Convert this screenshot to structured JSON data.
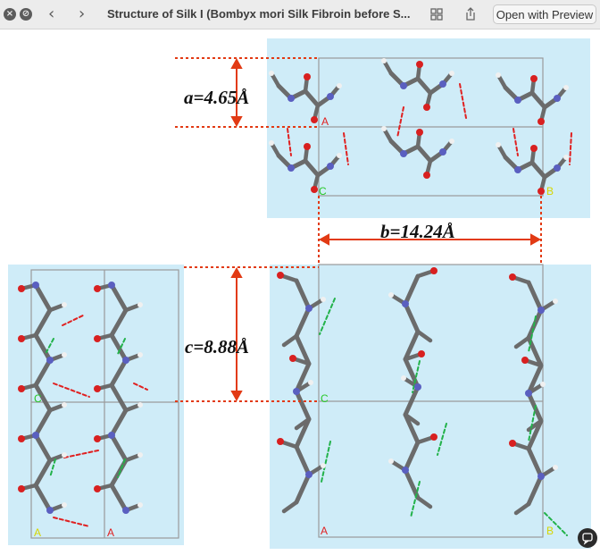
{
  "window": {
    "title": "Structure of Silk I (Bombyx mori Silk Fibroin before S...",
    "open_with_label": "Open with Preview"
  },
  "figure": {
    "label_a": "a=4.65Å",
    "label_b": "b=14.24Å",
    "label_c": "c=8.88Å",
    "atom_labels": {
      "top_A": "A",
      "top_C": "C",
      "top_B": "B",
      "bot_C": "C",
      "bot_A": "A",
      "bot_B": "B",
      "left_C": "C",
      "left_A1": "A",
      "left_A2": "A"
    }
  },
  "colors": {
    "panel_bg": "#cfecf8",
    "dim_line": "#e23a14",
    "carbon": "#6b6b6b",
    "nitrogen": "#5a5fc0",
    "oxygen": "#d82020",
    "hydrogen": "#f0f0f0",
    "hbond_red": "#e02020",
    "hbond_green": "#22b24a",
    "label_green": "#28c828",
    "label_yellow": "#d6d600"
  },
  "icons": [
    "close-icon",
    "stop-icon",
    "back-icon",
    "forward-icon",
    "grid-icon",
    "share-icon",
    "chat-icon"
  ]
}
